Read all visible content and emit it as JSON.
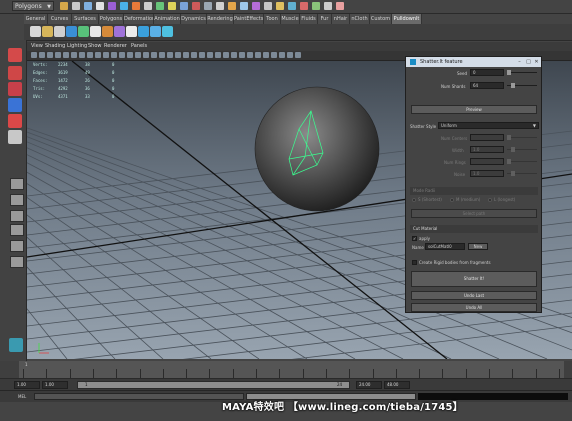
{
  "status_line": {
    "mode_menu": "Polygons",
    "icon_colors": [
      "#d6a84a",
      "#c9c9c9",
      "#7fb0e0",
      "#e2e2e2",
      "#9c5fd6",
      "#4ab0e8",
      "#e87a3a",
      "#cfcfcf",
      "#68c47a",
      "#e0d35a",
      "#7aa2d9",
      "#cf5a5a",
      "#9aa7b3",
      "#d0d0d0",
      "#e2a54a",
      "#9ec8ea",
      "#b56dd8",
      "#c7c7c7",
      "#e0c060",
      "#60b0d0",
      "#d86a6a",
      "#8ac47a",
      "#cccccc",
      "#e8a0a0"
    ]
  },
  "shelf": {
    "tabs": [
      "General",
      "Curves",
      "Surfaces",
      "Polygons",
      "Deformation",
      "Animation",
      "Dynamics",
      "Rendering",
      "PaintEffects",
      "Toon",
      "Muscle",
      "Fluids",
      "Fur",
      "nHair",
      "nCloth",
      "Custom",
      "Pulldownlt"
    ],
    "active_tab": "Pulldownlt",
    "icon_colors": [
      "#d8d8d8",
      "#d6b55a",
      "#cfcfcf",
      "#3a8fd6",
      "#58c07a",
      "#e7e7e7",
      "#d58a3a",
      "#9f72d9",
      "#ececec",
      "#3aa0dc",
      "#5ab0e6",
      "#4ec0e0"
    ]
  },
  "toolbox": {
    "tool_colors": [
      "#d44a4a",
      "#cf4747",
      "#c8404a",
      "#3a73d6",
      "#dc4848",
      "#c8c8c8"
    ],
    "layout_labels": [
      "",
      "",
      "",
      "",
      ""
    ]
  },
  "panel": {
    "menu": [
      "View",
      "Shading",
      "Lighting",
      "Show",
      "Renderer",
      "Panels"
    ]
  },
  "hud": {
    "rows": [
      {
        "label": "Verts:",
        "a": "2234",
        "b": "38",
        "c": "0"
      },
      {
        "label": "Edges:",
        "a": "3619",
        "b": "49",
        "c": "0"
      },
      {
        "label": "Faces:",
        "a": "1472",
        "b": "26",
        "c": "0"
      },
      {
        "label": "Tris:",
        "a": "4292",
        "b": "36",
        "c": "0"
      },
      {
        "label": "UVs:",
        "a": "4371",
        "b": "33",
        "c": "0"
      }
    ]
  },
  "shatter": {
    "title": "Shatter.lt feature",
    "seed_label": "Seed",
    "seed_value": "0",
    "shards_label": "Num Shards",
    "shards_value": "64",
    "preview_button": "Preview",
    "style_label": "Shatter Style",
    "style_value": "Uniform",
    "num_centers_label": "Num Centers",
    "width_label": "Width",
    "width_value": "1.0",
    "num_rings_label": "Num Rings",
    "noise_label": "Noise",
    "noise_value": "1.0",
    "mode_section": "Mode Radii",
    "radio_small": "S (Shortest)",
    "radio_medium": "M (medium)",
    "radio_large": "L (longest)",
    "select_path_button": "Select path",
    "cut_material_section": "Cut Material",
    "apply_label": "apply",
    "name_label": "Name",
    "name_value": "solCutMatl0",
    "new_button": "New",
    "rigid_label": "Create Rigid bodies from fragments",
    "shatter_button": "Shatter It!",
    "undo_last_button": "Undo Last",
    "undo_all_button": "Undo All"
  },
  "time": {
    "ticks": [
      "1",
      "",
      "",
      "",
      "",
      "",
      "",
      "",
      "",
      "",
      "",
      "",
      "",
      "",
      "",
      "",
      "",
      "",
      "",
      "",
      "",
      "",
      "",
      ""
    ],
    "range_start": "1.00",
    "range_start2": "1.00",
    "range_bar_start": "1",
    "range_bar_end": "24",
    "range_end": "24.00",
    "range_end2": "48.00",
    "command_label": "MEL"
  },
  "watermark": "MAYA特效吧 【www.lineg.com/tieba/1745】"
}
